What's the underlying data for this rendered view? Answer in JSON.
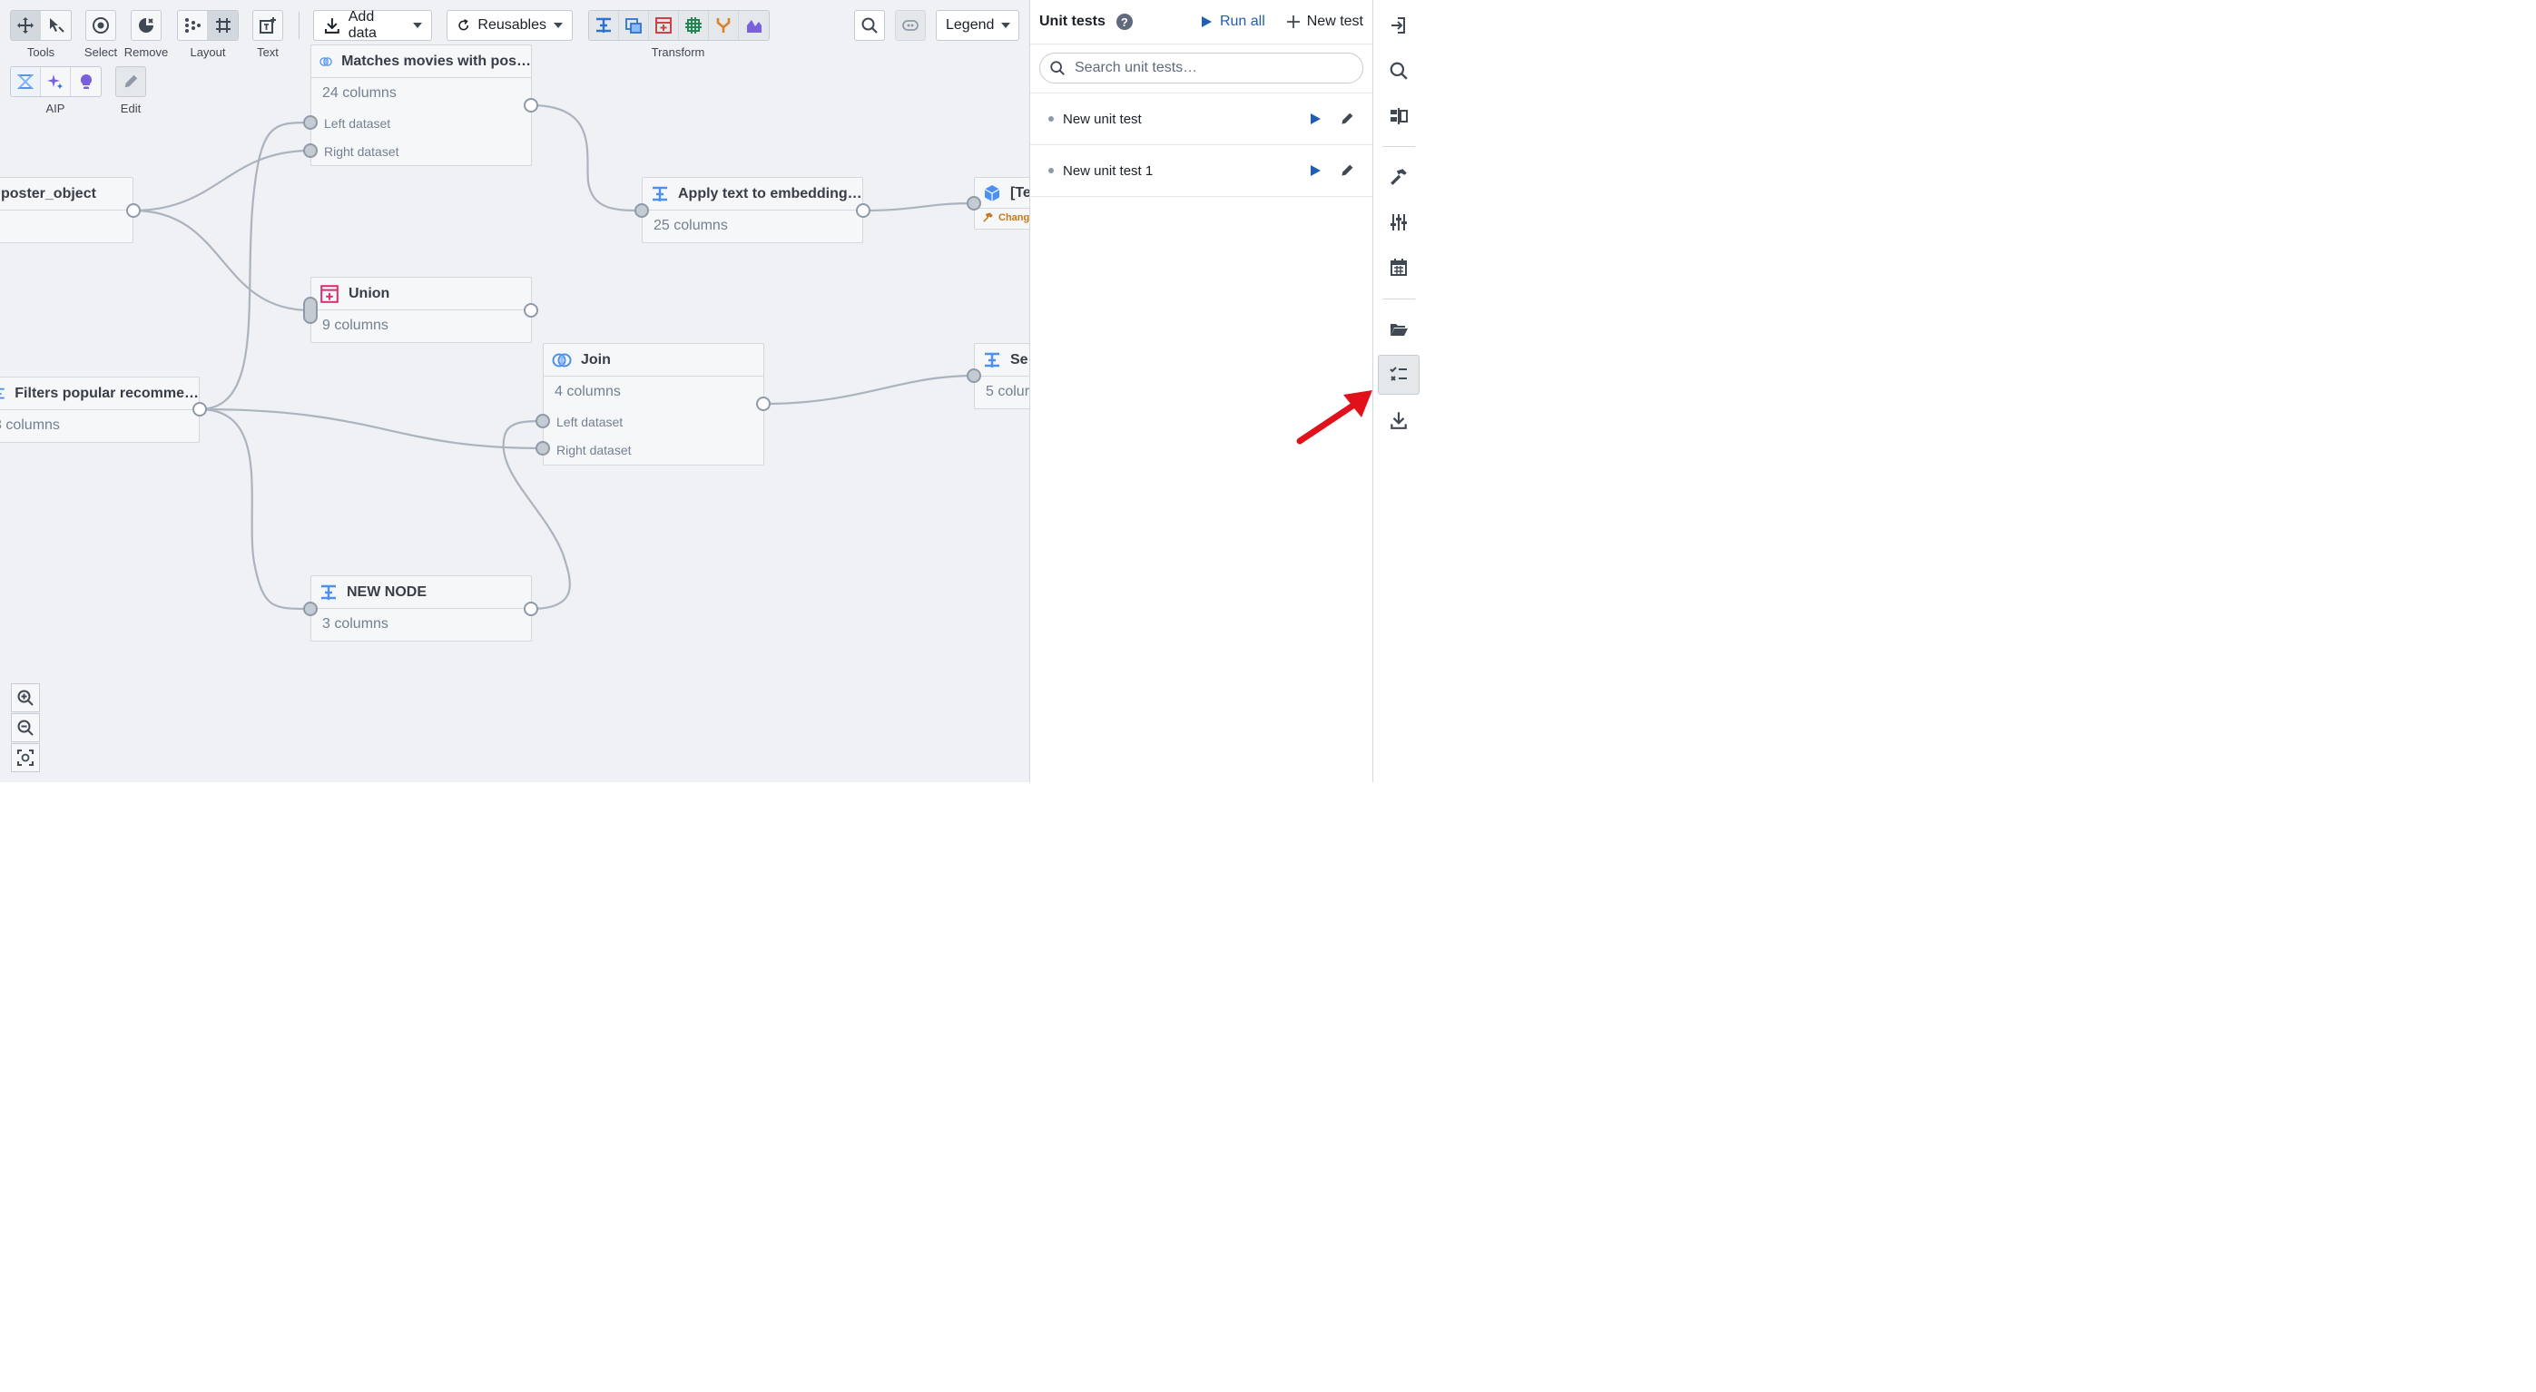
{
  "toolbar": {
    "tools_label": "Tools",
    "select_label": "Select",
    "remove_label": "Remove",
    "layout_label": "Layout",
    "text_label": "Text",
    "transform_label": "Transform",
    "aip_label": "AIP",
    "edit_label": "Edit",
    "add_data_label": "Add data",
    "reusables_label": "Reusables",
    "legend_label": "Legend"
  },
  "nodes": {
    "matches": {
      "title": "Matches movies with pos…",
      "columns": "24 columns",
      "left": "Left dataset",
      "right": "Right dataset"
    },
    "poster": {
      "title": "poster_object"
    },
    "apply": {
      "title": "Apply text to embedding…",
      "columns": "25 columns"
    },
    "output": {
      "title": "[Te",
      "tag": "Chang"
    },
    "union": {
      "title": "Union",
      "columns": "9 columns"
    },
    "join": {
      "title": "Join",
      "columns": "4 columns",
      "left": "Left dataset",
      "right": "Right dataset"
    },
    "filters": {
      "title": "Filters popular recomme…",
      "columns": "3 columns"
    },
    "se": {
      "title": "Se",
      "columns": "5 colur"
    },
    "new_node": {
      "title": "NEW NODE",
      "columns": "3 columns"
    }
  },
  "panel": {
    "title": "Unit tests",
    "run_all": "Run all",
    "new_test": "New test",
    "search_placeholder": "Search unit tests…",
    "tests": [
      {
        "name": "New unit test"
      },
      {
        "name": "New unit test 1"
      }
    ]
  },
  "colors": {
    "canvas_bg": "#eff1f5",
    "accent_blue": "#2d72d2",
    "annotation_arrow": "#e0111b"
  }
}
